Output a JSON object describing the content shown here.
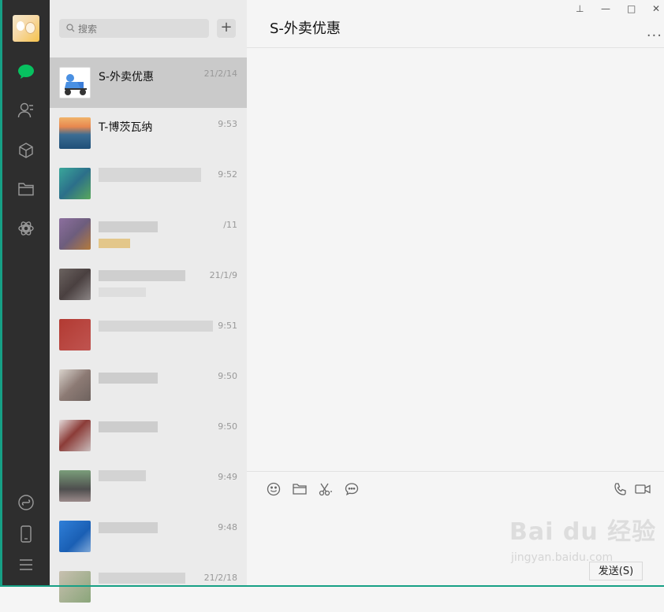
{
  "sidebar": {
    "icons": [
      "chat-icon",
      "contacts-icon",
      "favorites-icon",
      "files-icon",
      "moments-icon",
      "miniprogram-icon",
      "phone-icon",
      "menu-icon"
    ],
    "active_color": "#07c160"
  },
  "search": {
    "placeholder": "搜索",
    "add_label": "+"
  },
  "chats": [
    {
      "name": "S-外卖优惠",
      "time": "21/2/14"
    },
    {
      "name": "T-博茨瓦纳",
      "time": "9:53"
    },
    {
      "name": "",
      "time": "9:52"
    },
    {
      "name": "",
      "time": "/11"
    },
    {
      "name": "",
      "time": "21/1/9"
    },
    {
      "name": "",
      "time": "9:51"
    },
    {
      "name": "",
      "time": "9:50"
    },
    {
      "name": "",
      "time": "9:50"
    },
    {
      "name": "",
      "time": "9:49"
    },
    {
      "name": "",
      "time": "9:48"
    },
    {
      "name": "",
      "time": "21/2/18"
    }
  ],
  "conversation": {
    "title": "S-外卖优惠",
    "more": "...",
    "send_label": "发送(S)"
  },
  "window_controls": {
    "pin": "⊥",
    "minimize": "—",
    "maximize": "□",
    "close": "✕"
  },
  "watermark": {
    "main": "Bai du 经验",
    "sub": "jingyan.baidu.com"
  }
}
